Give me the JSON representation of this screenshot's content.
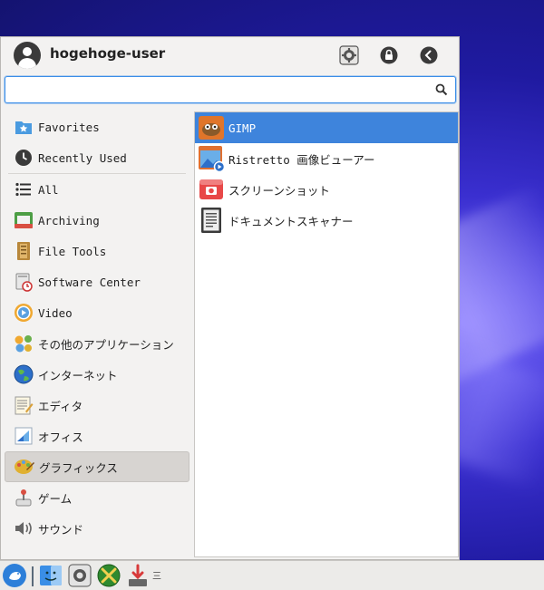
{
  "header": {
    "username": "hogehoge-user"
  },
  "search": {
    "value": "",
    "placeholder": ""
  },
  "sidebar": {
    "items": [
      {
        "label": "Favorites",
        "icon": "favorites-icon"
      },
      {
        "label": "Recently Used",
        "icon": "clock-icon"
      },
      {
        "label": "All",
        "icon": "list-icon"
      },
      {
        "label": "Archiving",
        "icon": "archive-icon"
      },
      {
        "label": "File Tools",
        "icon": "file-tools-icon"
      },
      {
        "label": "Software Center",
        "icon": "software-center-icon"
      },
      {
        "label": "Video",
        "icon": "video-icon"
      },
      {
        "label": "その他のアプリケーション",
        "icon": "other-apps-icon"
      },
      {
        "label": "インターネット",
        "icon": "internet-icon"
      },
      {
        "label": "エディタ",
        "icon": "editor-icon"
      },
      {
        "label": "オフィス",
        "icon": "office-icon"
      },
      {
        "label": "グラフィックス",
        "icon": "graphics-icon"
      },
      {
        "label": "ゲーム",
        "icon": "game-icon"
      },
      {
        "label": "サウンド",
        "icon": "sound-icon"
      }
    ],
    "active_index": 11
  },
  "apps": {
    "items": [
      {
        "label": "GIMP",
        "icon": "gimp-icon"
      },
      {
        "label": "Ristretto 画像ビューアー",
        "icon": "image-viewer-icon"
      },
      {
        "label": "スクリーンショット",
        "icon": "camera-icon"
      },
      {
        "label": "ドキュメントスキャナー",
        "icon": "scanner-icon"
      }
    ],
    "selected_index": 0
  },
  "taskbar": {
    "overflow_text": "三"
  },
  "colors": {
    "accent": "#3e84dc",
    "menu_bg": "#f3f2f1"
  }
}
